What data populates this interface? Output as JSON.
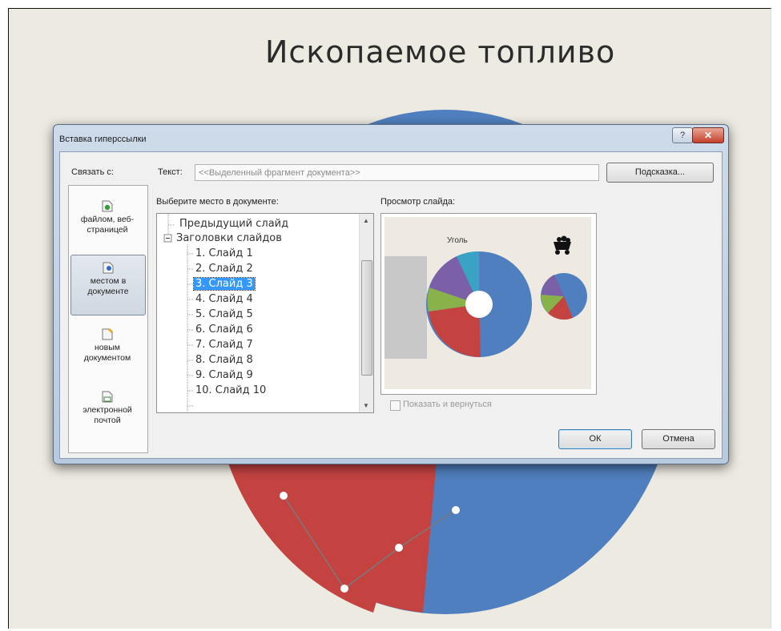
{
  "slide": {
    "title": "Ископаемое топливо",
    "chart_colors": {
      "blue": "#4f7fbe",
      "red": "#c44341"
    }
  },
  "dialog": {
    "title": "Вставка гиперссылки",
    "help_label": "?",
    "close_label": "✕",
    "link_to_label": "Связать с:",
    "text_label": "Текст:",
    "text_value": "<<Выделенный фрагмент документа>>",
    "hint_button": "Подсказка...",
    "link_options": [
      {
        "label": "файлом, веб-страницей",
        "icon": "web-page-icon"
      },
      {
        "label": "местом в документе",
        "icon": "document-place-icon"
      },
      {
        "label": "новым документом",
        "icon": "new-document-icon"
      },
      {
        "label": "электронной почтой",
        "icon": "email-icon"
      }
    ],
    "place_label": "Выберите место в документе:",
    "tree": {
      "prev_slide": "Предыдущий слайд",
      "group": "Заголовки слайдов",
      "slides": [
        "1. Слайд 1",
        "2. Слайд 2",
        "3. Слайд 3",
        "4. Слайд 4",
        "5. Слайд 5",
        "6. Слайд 6",
        "7. Слайд 7",
        "8. Слайд 8",
        "9. Слайд 9",
        "10. Слайд 10"
      ],
      "selected_index": 2
    },
    "preview_label": "Просмотр слайда:",
    "preview_title": "Уголь",
    "show_and_return_label": "Показать и вернуться",
    "ok_label": "ОК",
    "cancel_label": "Отмена"
  }
}
